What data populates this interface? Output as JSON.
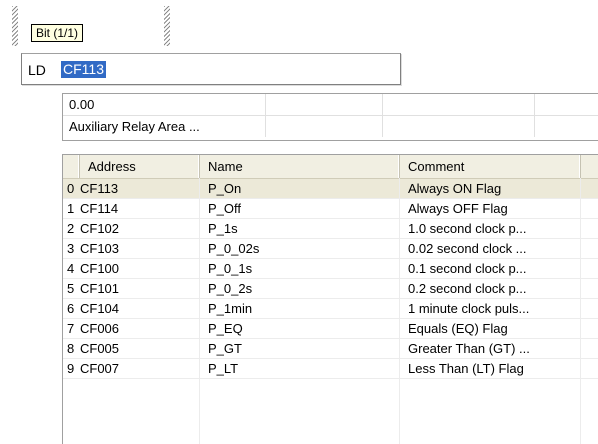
{
  "tooltip": {
    "text": "Bit (1/1)"
  },
  "instruction": {
    "mnemonic": "LD",
    "operand": "CF113"
  },
  "info": {
    "value": "0.00",
    "area": "Auxiliary Relay Area ..."
  },
  "table": {
    "headers": {
      "address": "Address",
      "name": "Name",
      "comment": "Comment"
    },
    "rows": [
      {
        "index": "0",
        "address": "CF113",
        "name": "P_On",
        "comment": "Always ON Flag"
      },
      {
        "index": "1",
        "address": "CF114",
        "name": "P_Off",
        "comment": "Always OFF Flag"
      },
      {
        "index": "2",
        "address": "CF102",
        "name": "P_1s",
        "comment": "1.0 second clock p..."
      },
      {
        "index": "3",
        "address": "CF103",
        "name": "P_0_02s",
        "comment": "0.02 second clock ..."
      },
      {
        "index": "4",
        "address": "CF100",
        "name": "P_0_1s",
        "comment": "0.1 second clock p..."
      },
      {
        "index": "5",
        "address": "CF101",
        "name": "P_0_2s",
        "comment": "0.2 second clock p..."
      },
      {
        "index": "6",
        "address": "CF104",
        "name": "P_1min",
        "comment": "1 minute clock puls..."
      },
      {
        "index": "7",
        "address": "CF006",
        "name": "P_EQ",
        "comment": "Equals (EQ) Flag"
      },
      {
        "index": "8",
        "address": "CF005",
        "name": "P_GT",
        "comment": "Greater Than (GT) ..."
      },
      {
        "index": "9",
        "address": "CF007",
        "name": "P_LT",
        "comment": "Less Than (LT) Flag"
      }
    ],
    "selected_row": "0"
  },
  "colors": {
    "tooltip_bg": "#ffffe1",
    "selection": "#316ac5",
    "header_bg": "#f1efe2",
    "selected_row_bg": "#ece9d8"
  }
}
